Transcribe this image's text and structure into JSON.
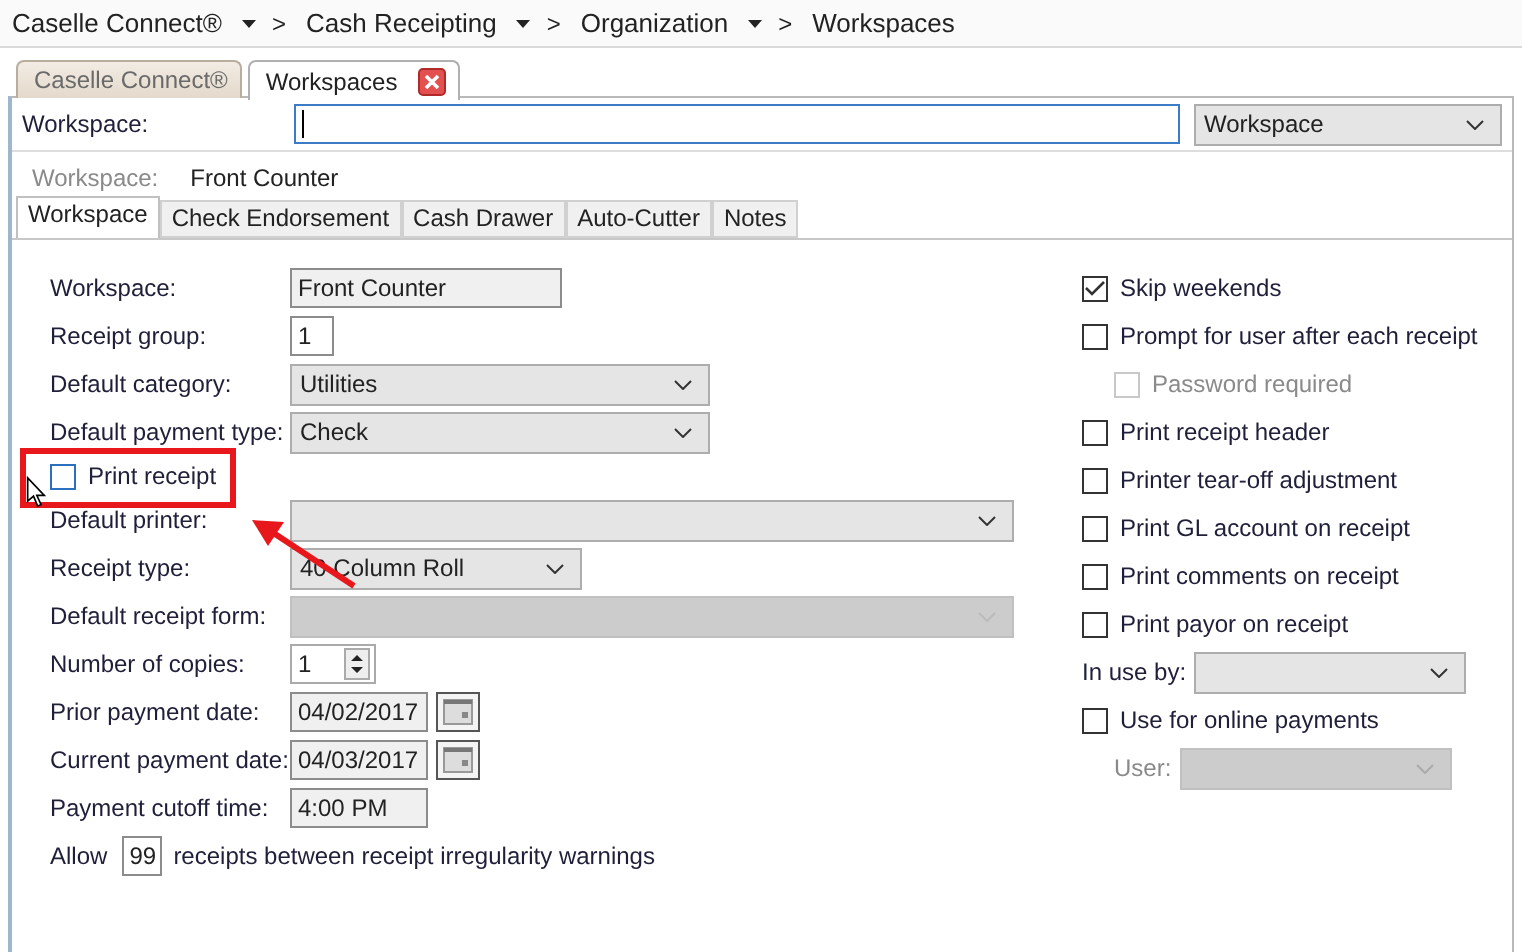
{
  "breadcrumb": {
    "separator": ">",
    "items": [
      {
        "label": "Caselle Connect®"
      },
      {
        "label": "Cash Receipting"
      },
      {
        "label": "Organization"
      },
      {
        "label": "Workspaces"
      }
    ]
  },
  "window_tabs": [
    {
      "label": "Caselle Connect®",
      "selected": false,
      "closable": false
    },
    {
      "label": "Workspaces",
      "selected": true,
      "closable": true
    }
  ],
  "search": {
    "label": "Workspace:",
    "type": "Workspace"
  },
  "current": {
    "label": "Workspace:",
    "value": "Front Counter"
  },
  "tabs": [
    {
      "label": "Workspace",
      "selected": true
    },
    {
      "label": "Check Endorsement",
      "selected": false
    },
    {
      "label": "Cash Drawer",
      "selected": false
    },
    {
      "label": "Auto-Cutter",
      "selected": false
    },
    {
      "label": "Notes",
      "selected": false
    }
  ],
  "left_fields": [
    {
      "kind": "text",
      "label": "Workspace:",
      "value": "Front Counter",
      "editable": false
    },
    {
      "kind": "text",
      "label": "Receipt group:",
      "value": "1",
      "editable": true
    },
    {
      "kind": "dropdown",
      "label": "Default category:",
      "value": "Utilities",
      "disabled": false
    },
    {
      "kind": "dropdown",
      "label": "Default payment type:",
      "value": "Check",
      "disabled": false
    },
    {
      "kind": "checkbox",
      "label": "Print receipt",
      "checked": false
    },
    {
      "kind": "dropdown",
      "label": "Default printer:",
      "disabled": false
    },
    {
      "kind": "dropdown",
      "label": "Receipt type:",
      "value": "40 Column Roll",
      "disabled": false
    },
    {
      "kind": "dropdown",
      "label": "Default receipt form:",
      "disabled": true
    },
    {
      "kind": "spinner",
      "label": "Number of copies:",
      "value": "1"
    },
    {
      "kind": "date",
      "label": "Prior payment date:",
      "value": "04/02/2017"
    },
    {
      "kind": "date",
      "label": "Current payment date:",
      "value": "04/03/2017"
    },
    {
      "kind": "text",
      "label": "Payment cutoff time:",
      "value": "4:00 PM",
      "editable": false
    },
    {
      "kind": "allow",
      "label": "Allow",
      "value": "99",
      "suffix": "receipts between receipt irregularity warnings"
    }
  ],
  "right_fields": [
    {
      "kind": "checkbox",
      "label": "Skip weekends",
      "checked": true,
      "disabled": false
    },
    {
      "kind": "checkbox",
      "label": "Prompt for user after each receipt",
      "checked": false,
      "disabled": false,
      "children": [
        {
          "kind": "checkbox",
          "label": "Password required",
          "checked": false,
          "disabled": true
        }
      ]
    },
    {
      "kind": "checkbox",
      "label": "Print receipt header",
      "checked": false,
      "disabled": false
    },
    {
      "kind": "checkbox",
      "label": "Printer tear-off adjustment",
      "checked": false,
      "disabled": false
    },
    {
      "kind": "checkbox",
      "label": "Print GL account on receipt",
      "checked": false,
      "disabled": false
    },
    {
      "kind": "checkbox",
      "label": "Print comments on receipt",
      "checked": false,
      "disabled": false
    },
    {
      "kind": "checkbox",
      "label": "Print payor on receipt",
      "checked": false,
      "disabled": false
    },
    {
      "kind": "dropdown",
      "label": "In use by:",
      "disabled": false
    },
    {
      "kind": "checkbox",
      "label": "Use for online payments",
      "checked": false,
      "disabled": false,
      "children": [
        {
          "kind": "dropdown",
          "label": "User:",
          "disabled": true
        }
      ]
    }
  ]
}
